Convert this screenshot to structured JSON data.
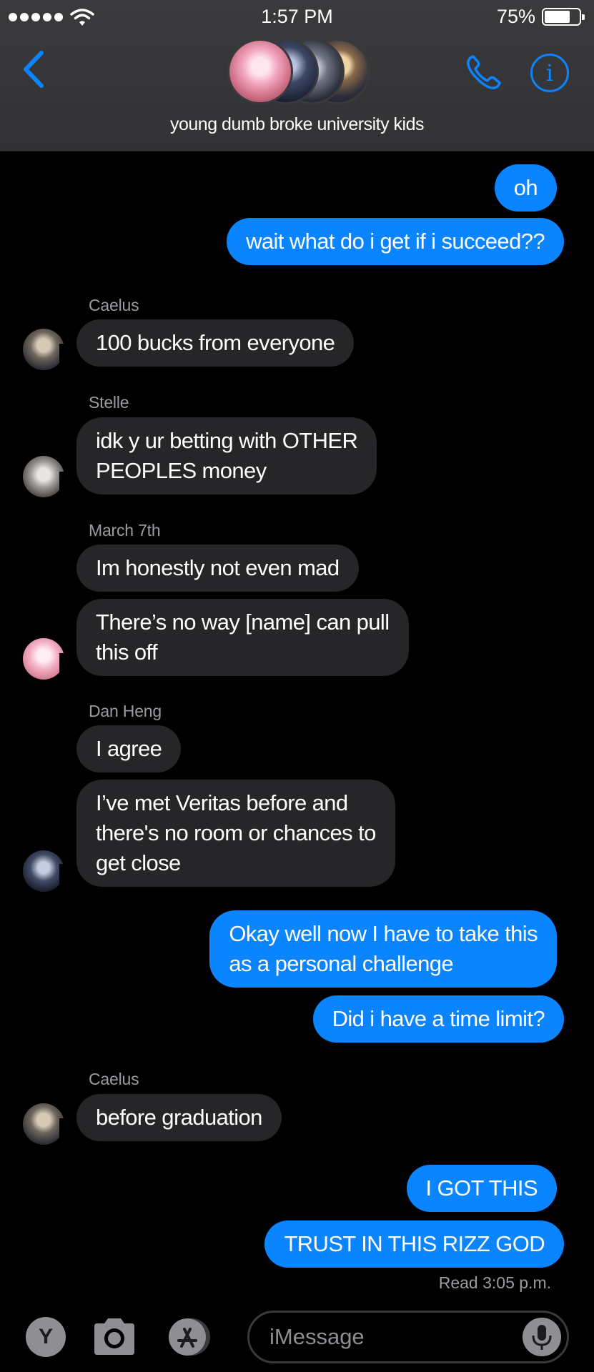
{
  "status_bar": {
    "time": "1:57 PM",
    "battery_percent": "75%",
    "battery_level": 0.75,
    "signal_dots": 5
  },
  "header": {
    "group_title": "young dumb broke university kids",
    "accent_color": "#0a84ff"
  },
  "messages": [
    {
      "side": "out",
      "text": "oh"
    },
    {
      "side": "out",
      "text": "wait what do i get if i succeed??"
    },
    {
      "side": "in",
      "sender": "Caelus",
      "text": "100 bucks from everyone"
    },
    {
      "side": "in",
      "sender": "Stelle",
      "lines": [
        "idk y ur betting with OTHER",
        "PEOPLES money"
      ]
    },
    {
      "side": "in",
      "sender": "March 7th",
      "text": "Im honestly not even mad"
    },
    {
      "side": "in",
      "lines": [
        "There’s no way [name] can pull",
        "this off"
      ]
    },
    {
      "side": "in",
      "sender": "Dan Heng",
      "text": "I agree"
    },
    {
      "side": "in",
      "lines": [
        "I’ve met Veritas before and",
        "there's no room or chances to",
        "get close"
      ]
    },
    {
      "side": "out",
      "lines": [
        "Okay well now I have to take this",
        "as a personal challenge"
      ]
    },
    {
      "side": "out",
      "text": "Did i have a time limit?"
    },
    {
      "side": "in",
      "sender": "Caelus",
      "text": "before graduation"
    },
    {
      "side": "out",
      "text": "I GOT THIS"
    },
    {
      "side": "out",
      "text": "TRUST IN THIS RIZZ GOD"
    }
  ],
  "read_receipt": "Read 3:05 p.m.",
  "input_bar": {
    "app_y_label": "Y",
    "placeholder": "iMessage",
    "value": ""
  },
  "icons": [
    "wifi-icon",
    "back-chevron-icon",
    "phone-icon",
    "info-icon",
    "camera-icon",
    "app-store-icon",
    "microphone-icon"
  ],
  "colors": {
    "outgoing_bubble": "#0a84ff",
    "incoming_bubble": "#262628",
    "background": "#000000",
    "header": "#3a3a3c"
  }
}
